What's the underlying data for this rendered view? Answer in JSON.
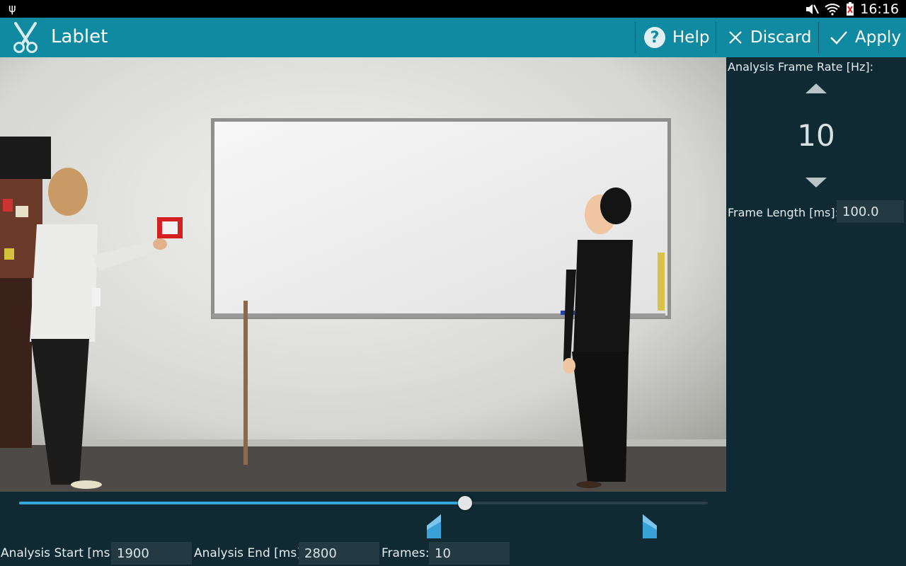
{
  "status_bar": {
    "time": "16:16"
  },
  "action_bar": {
    "title": "Lablet",
    "help_label": "Help",
    "discard_label": "Discard",
    "apply_label": "Apply"
  },
  "side_panel": {
    "frame_rate_label": "Analysis Frame Rate [Hz]:",
    "frame_rate_value": "10",
    "frame_length_label": "Frame Length [ms]:",
    "frame_length_value": "100.0"
  },
  "seek": {
    "progress": 0.647
  },
  "bottom": {
    "start_label": "Analysis Start [ms]:",
    "start_value": "1900",
    "end_label": "Analysis End [ms]:",
    "end_value": "2800",
    "frames_label": "Frames:",
    "frames_value": "10"
  },
  "colors": {
    "action_bar": "#0f8aa0",
    "background": "#0f2a33",
    "accent": "#33a8d8"
  }
}
